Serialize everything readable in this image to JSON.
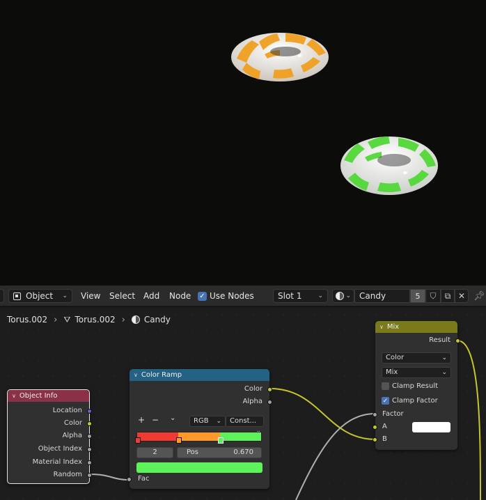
{
  "header": {
    "mode_label": "Object",
    "menus": [
      "View",
      "Select",
      "Add",
      "Node"
    ],
    "use_nodes_label": "Use Nodes",
    "slot_label": "Slot 1",
    "material_name": "Candy",
    "user_count": "5"
  },
  "breadcrumb": {
    "object": "Torus.002",
    "mesh": "Torus.002",
    "material": "Candy"
  },
  "nodes": {
    "object_info": {
      "title": "Object Info",
      "outputs": [
        "Location",
        "Color",
        "Alpha",
        "Object Index",
        "Material Index",
        "Random"
      ]
    },
    "color_ramp": {
      "title": "Color Ramp",
      "outputs": [
        "Color",
        "Alpha"
      ],
      "color_mode": "RGB",
      "interpolation": "Const...",
      "plus": "+",
      "minus": "−",
      "stop_index": "2",
      "pos_label": "Pos",
      "pos_value": "0.670",
      "input": "Fac",
      "stops": [
        {
          "pos": 0.0,
          "color": "#f03a32"
        },
        {
          "pos": 0.33,
          "color": "#ff9a2a"
        },
        {
          "pos": 0.67,
          "color": "#5ef25a"
        }
      ],
      "selected_color": "#5ef25a"
    },
    "mix": {
      "title": "Mix",
      "output": "Result",
      "data_type": "Color",
      "blend_mode": "Mix",
      "clamp_result": "Clamp Result",
      "clamp_factor": "Clamp Factor",
      "inputs": [
        "Factor",
        "A",
        "B"
      ]
    }
  },
  "colors": {
    "object_info_header": "#8a3047",
    "color_ramp_header": "#246283",
    "mix_header": "#7a7a1a",
    "accent_blue": "#4772b3"
  }
}
